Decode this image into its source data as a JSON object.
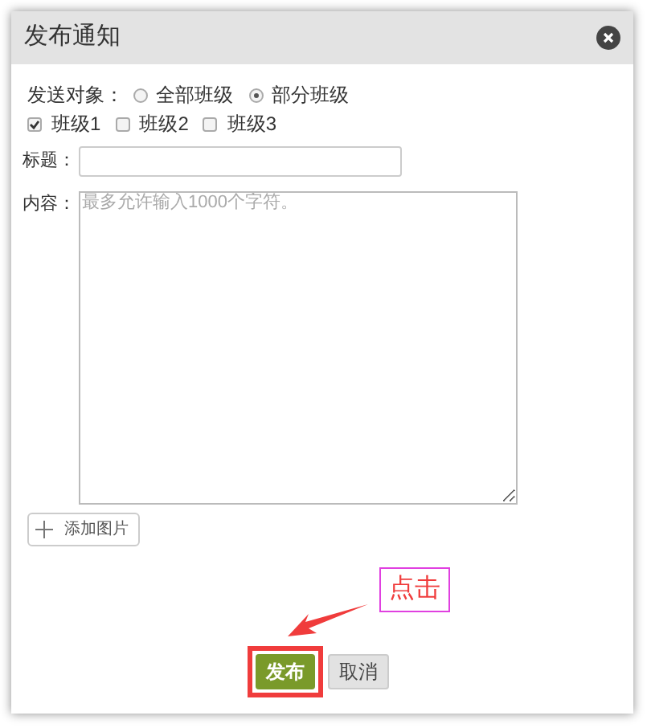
{
  "dialog": {
    "title": "发布通知",
    "target_label": "发送对象：",
    "target_options": [
      {
        "label": "全部班级",
        "selected": false
      },
      {
        "label": "部分班级",
        "selected": true
      }
    ],
    "classes": [
      {
        "label": "班级1",
        "checked": true
      },
      {
        "label": "班级2",
        "checked": false
      },
      {
        "label": "班级3",
        "checked": false
      }
    ],
    "title_label": "标题：",
    "content_label": "内容：",
    "content_placeholder": "最多允许输入1000个字符。",
    "add_image_button": "添加图片",
    "buttons": [
      {
        "label": "发布",
        "kind": "primary",
        "highlighted": true
      },
      {
        "label": "取消",
        "kind": "secondary",
        "highlighted": false
      }
    ]
  },
  "annotation": {
    "label": "点击"
  }
}
